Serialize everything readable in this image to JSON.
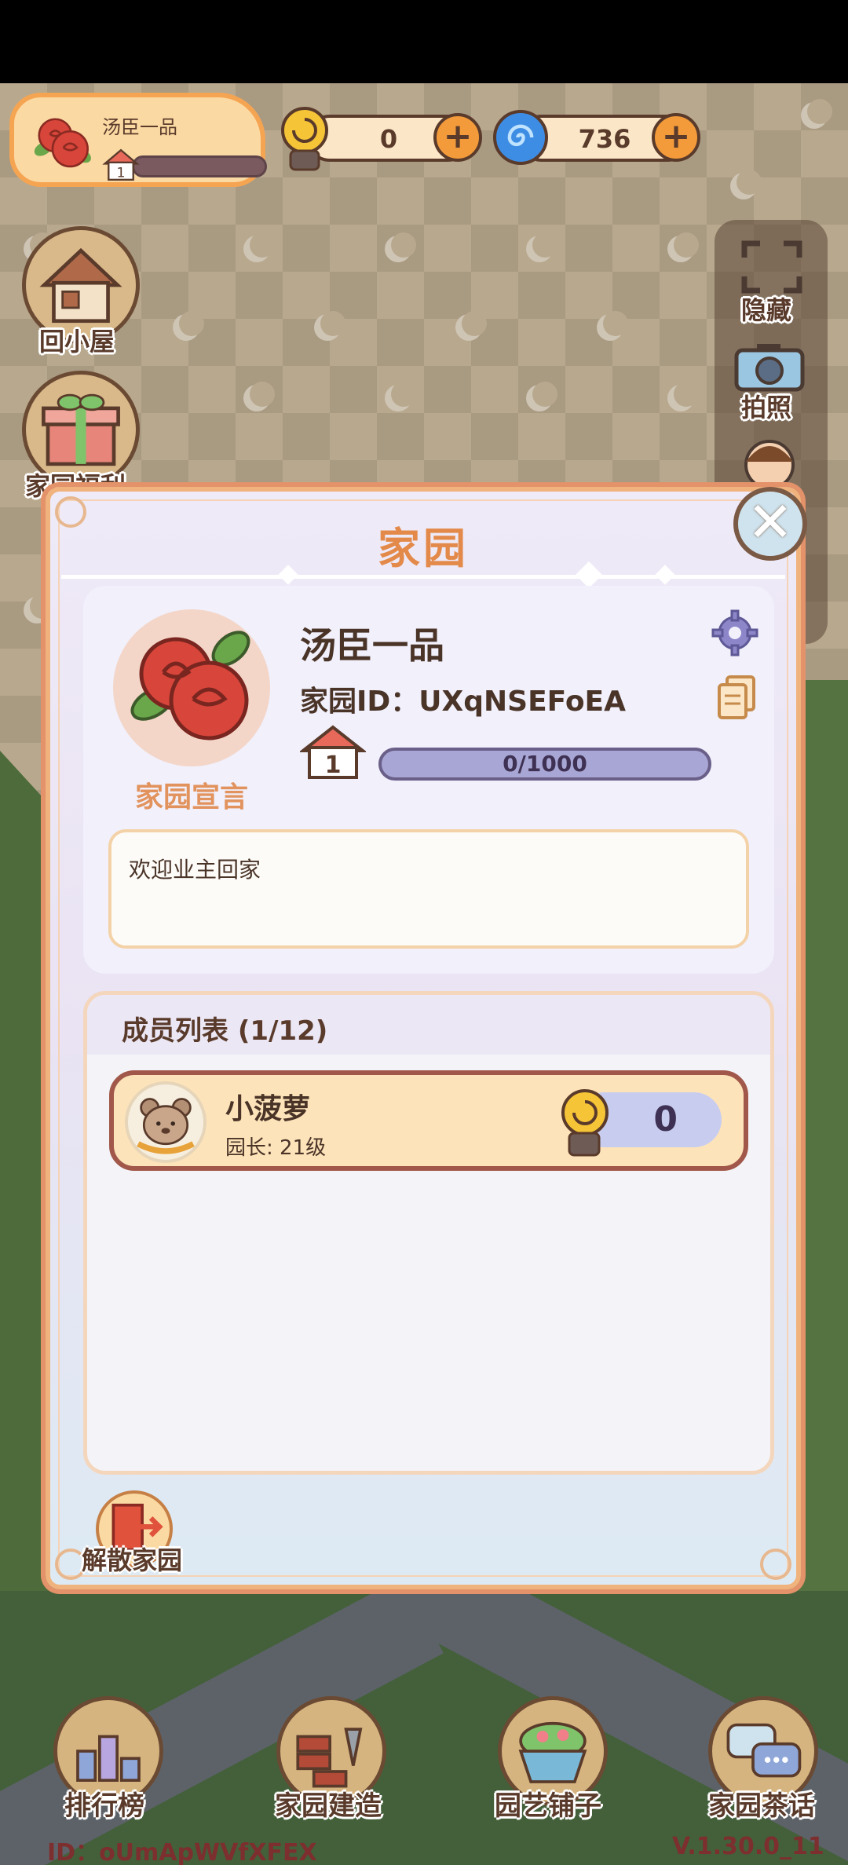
{
  "top_bar": {
    "profile_name": "汤臣一品",
    "profile_level": "1",
    "snail_currency": "0",
    "swirl_currency": "736"
  },
  "side_menu": {
    "back_home": "回小屋",
    "welfare": "家园福利",
    "hide": "隐藏",
    "photo": "拍照"
  },
  "modal": {
    "title": "家园",
    "home_name": "汤臣一品",
    "home_id": "家园ID：UXqNSEFoEA",
    "level": "1",
    "progress_text": "0/1000",
    "progress_fraction": 0,
    "declaration_label": "家园宣言",
    "declaration_text": "欢迎业主回家",
    "members_title": "成员列表 (1/12)",
    "members": [
      {
        "name": "小菠萝",
        "role": "园长: 21级",
        "score": "0"
      }
    ],
    "dissolve_label": "解散家园"
  },
  "bottom_nav": {
    "items": [
      "排行榜",
      "家园建造",
      "园艺铺子",
      "家园茶话"
    ]
  },
  "footer": {
    "id_text": "ID：oUmApWVfXFEX",
    "version": "V.1.30.0_11"
  },
  "colors": {
    "accent_orange": "#e38a4a",
    "card_border": "#a1584a",
    "progress_fill": "#a7a6d4"
  },
  "icons": [
    "rose-avatar-icon",
    "house-level-icon",
    "snail-icon",
    "swirl-icon",
    "plus-icon",
    "gear-icon",
    "copy-icon",
    "close-icon",
    "bear-avatar-icon",
    "exit-door-icon",
    "house-icon",
    "gift-icon",
    "fullscreen-icon",
    "camera-icon",
    "trophy-icon",
    "bricks-icon",
    "flower-basket-icon",
    "chat-icon"
  ]
}
